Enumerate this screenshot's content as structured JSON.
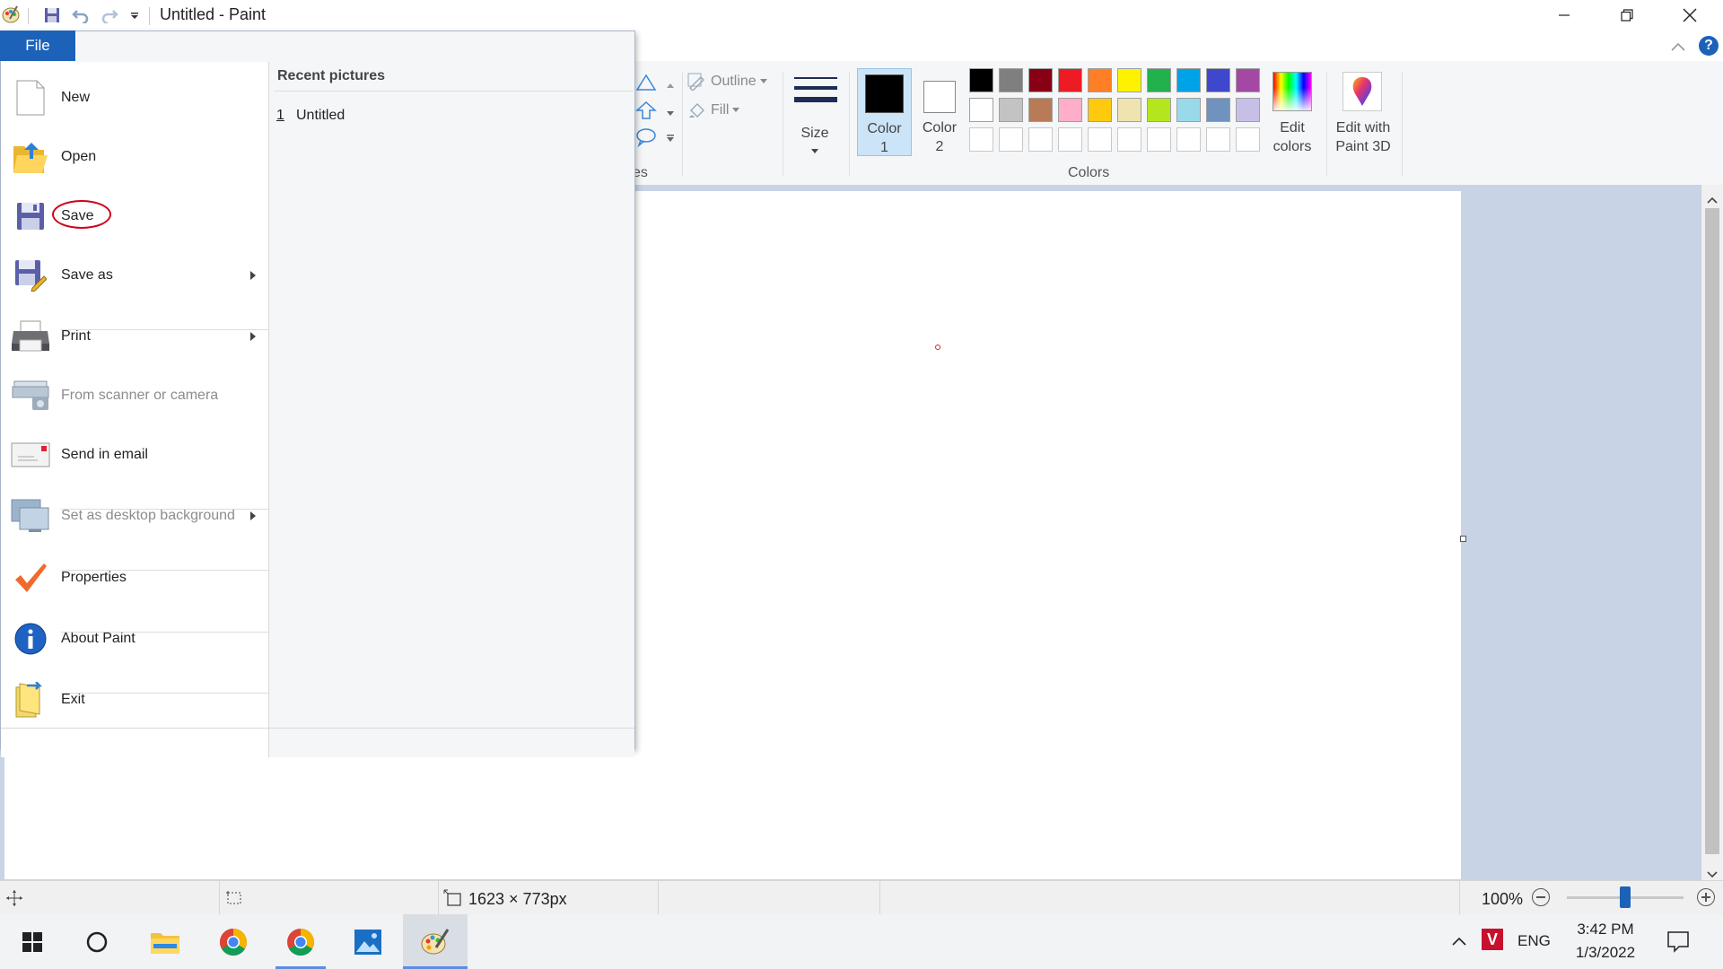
{
  "window": {
    "title": "Untitled - Paint"
  },
  "file_tab": {
    "label": "File"
  },
  "file_menu": {
    "items": [
      {
        "label": "New",
        "icon": "new-file-icon",
        "disabled": false
      },
      {
        "label": "Open",
        "icon": "open-folder-icon",
        "disabled": false
      },
      {
        "label": "Save",
        "icon": "save-disk-icon",
        "disabled": false,
        "highlighted": true
      },
      {
        "label": "Save as",
        "icon": "save-as-icon",
        "disabled": false,
        "submenu": true
      },
      {
        "label": "Print",
        "icon": "printer-icon",
        "disabled": false,
        "submenu": true
      },
      {
        "label": "From scanner or camera",
        "icon": "scanner-icon",
        "disabled": true
      },
      {
        "label": "Send in email",
        "icon": "email-icon",
        "disabled": false
      },
      {
        "label": "Set as desktop background",
        "icon": "desktop-icon",
        "disabled": true,
        "submenu": true
      },
      {
        "label": "Properties",
        "icon": "checkmark-icon",
        "disabled": false
      },
      {
        "label": "About Paint",
        "icon": "info-icon",
        "disabled": false
      },
      {
        "label": "Exit",
        "icon": "exit-icon",
        "disabled": false
      }
    ],
    "recent": {
      "heading": "Recent pictures",
      "items": [
        {
          "number": "1",
          "name": "Untitled"
        }
      ]
    }
  },
  "ribbon": {
    "shapes_group_label_fragment": "es",
    "outline_label": "Outline",
    "fill_label": "Fill",
    "size_label": "Size",
    "color1_label": "Color\n1",
    "color2_label": "Color\n2",
    "color1_value": "#000000",
    "color2_value": "#ffffff",
    "colors_group_label": "Colors",
    "edit_colors_label": "Edit\ncolors",
    "edit_paint3d_label": "Edit with\nPaint 3D",
    "palette_row1": [
      "#000000",
      "#7f7f7f",
      "#880015",
      "#ed1c24",
      "#ff7f27",
      "#fff200",
      "#22b14c",
      "#00a2e8",
      "#3f48cc",
      "#a349a4"
    ],
    "palette_row2": [
      "#ffffff",
      "#c3c3c3",
      "#b97a57",
      "#ffaec9",
      "#ffc90e",
      "#efe4b0",
      "#b5e61d",
      "#99d9ea",
      "#7092be",
      "#c8bfe7"
    ]
  },
  "statusbar": {
    "dimensions": "1623 × 773px",
    "zoom": "100%",
    "zoom_level": 1.0
  },
  "taskbar": {
    "language": "ENG",
    "time": "3:42 PM",
    "date": "1/3/2022"
  }
}
